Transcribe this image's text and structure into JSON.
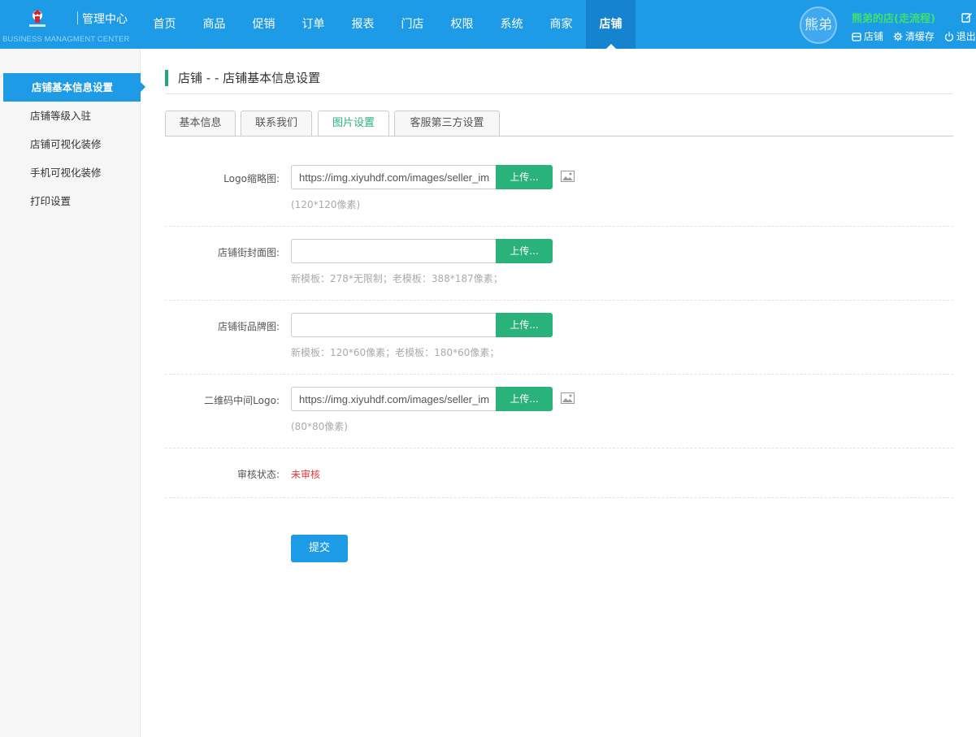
{
  "header": {
    "logo_title": "管理中心",
    "logo_subtitle": "BUSINESS MANAGMENT CENTER",
    "nav": [
      {
        "label": "首页"
      },
      {
        "label": "商品"
      },
      {
        "label": "促销"
      },
      {
        "label": "订单"
      },
      {
        "label": "报表"
      },
      {
        "label": "门店"
      },
      {
        "label": "权限"
      },
      {
        "label": "系统"
      },
      {
        "label": "商家"
      },
      {
        "label": "店铺",
        "active": true
      }
    ],
    "avatar_text": "熊弟",
    "shop_name": "熊弟的店(走流程)",
    "links": {
      "shop": "店铺",
      "clear_cache": "清缓存",
      "logout": "退出"
    }
  },
  "sidebar": {
    "items": [
      {
        "label": "店铺基本信息设置",
        "active": true
      },
      {
        "label": "店铺等级入驻"
      },
      {
        "label": "店铺可视化装修"
      },
      {
        "label": "手机可视化装修"
      },
      {
        "label": "打印设置"
      }
    ]
  },
  "main": {
    "title": "店铺 - - 店铺基本信息设置",
    "tabs": [
      {
        "label": "基本信息"
      },
      {
        "label": "联系我们"
      },
      {
        "label": "图片设置",
        "active": true
      },
      {
        "label": "客服第三方设置"
      }
    ],
    "form": {
      "logo": {
        "label": "Logo缩略图:",
        "value": "https://img.xiyuhdf.com/images/seller_im",
        "upload": "上传...",
        "hint": "(120*120像素)"
      },
      "cover": {
        "label": "店铺街封面图:",
        "value": "",
        "upload": "上传...",
        "hint": "新模板：278*无限制；老模板：388*187像素；"
      },
      "brand": {
        "label": "店铺街品牌图:",
        "value": "",
        "upload": "上传...",
        "hint": "新模板：120*60像素；老模板：180*60像素；"
      },
      "qr_logo": {
        "label": "二维码中间Logo:",
        "value": "https://img.xiyuhdf.com/images/seller_im",
        "upload": "上传...",
        "hint": "(80*80像素)"
      },
      "audit": {
        "label": "审核状态:",
        "value": "未审核"
      }
    },
    "submit_label": "提交"
  },
  "colors": {
    "primary": "#1e9be6",
    "primary_dark": "#1583cf",
    "success": "#2ab27b",
    "shop_name": "#3ee06f",
    "status_red": "#e4393c",
    "title_accent": "#1ea97c"
  }
}
